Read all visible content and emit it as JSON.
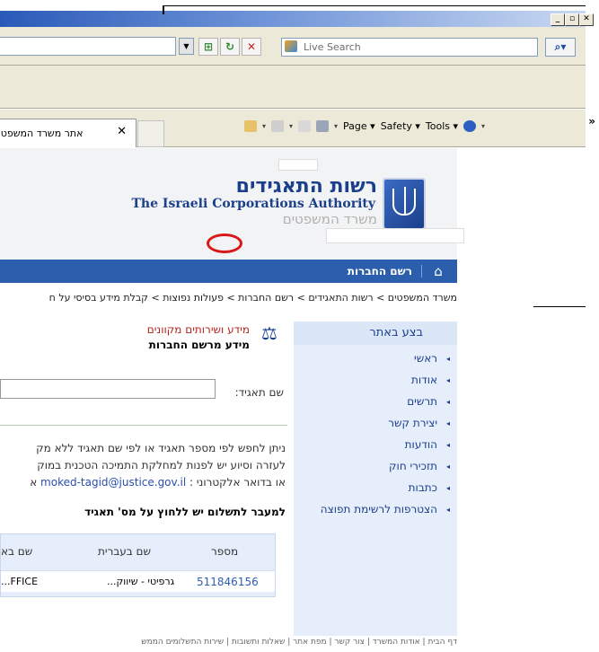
{
  "window": {
    "controls": [
      "_",
      "▫",
      "✕"
    ]
  },
  "search": {
    "placeholder": "Live Search",
    "go_icon": "magnifier-icon"
  },
  "tab": {
    "title": "אתר משרד המשפטים",
    "close": "✕"
  },
  "command_bar": {
    "page": "Page ▾",
    "safety": "Safety ▾",
    "tools": "Tools ▾",
    "chevron": "»"
  },
  "header": {
    "org_hebrew": "רשות התאגידים",
    "org_english": "The Israeli Corporations Authority",
    "ministry": "משרד המשפטים"
  },
  "nav": {
    "companies_registrar": "רשם החברות",
    "home_icon": "home-icon"
  },
  "breadcrumb": "משרד המשפטים > רשות התאגידים > רשם החברות > פעולות נפוצות > קבלת מידע בסיסי על ח",
  "sidebar": {
    "heading": "בצע באתר",
    "items": [
      "ראשי",
      "אודות",
      "תרשים",
      "יצירת קשר",
      "הודעות",
      "תזכירי חוק",
      "כתבות",
      "הצטרפות לרשימת תפוצה"
    ]
  },
  "main": {
    "section_title": "מידע ושירותים מקוונים",
    "section_subtitle": "מידע מרשם החברות",
    "field_label": "שם תאגיד:",
    "info_line1": "ניתן לחפש לפי מספר תאגיד או לפי שם תאגיד ללא מק",
    "info_line2": "לעזרה וסיוע יש לפנות למחלקת התמיכה הטכנית במוק",
    "info_line3_prefix": "או בדואר אלקטרוני : ",
    "info_email": "moked-tagid@justice.gov.il",
    "info_line3_suffix": " א",
    "bold_note": "למעבר לתשלום יש ללחוץ על מס' תאגיד",
    "table": {
      "headers": [
        "מספר",
        "שם בעברית",
        "שם בא"
      ],
      "rows": [
        {
          "number": "511846156",
          "hebrew_name": "גרפיטי - שיווק...",
          "english_name": "FFICE..."
        }
      ]
    }
  },
  "footer": "דף הבית | אודות המשרד | צור קשר | מפת אתר | שאלות ותשובות | שירות התשלומים הממש"
}
